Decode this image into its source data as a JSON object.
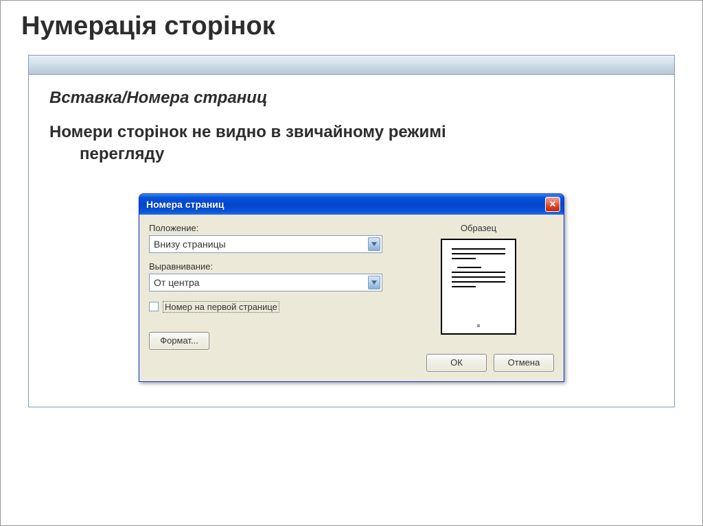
{
  "slide": {
    "title": "Нумерація сторінок",
    "subtitle": "Вставка/Номера страниц",
    "description_line1": "Номери сторінок не видно в звичайному режимі",
    "description_line2": "перегляду"
  },
  "dialog": {
    "title": "Номера страниц",
    "close_symbol": "✕",
    "position_label": "Положение:",
    "position_value": "Внизу страницы",
    "alignment_label": "Выравнивание:",
    "alignment_value": "От центра",
    "checkbox_label": "Номер на первой странице",
    "preview_label": "Образец",
    "preview_footer": "=",
    "format_button": "Формат...",
    "ok_button": "ОК",
    "cancel_button": "Отмена"
  }
}
